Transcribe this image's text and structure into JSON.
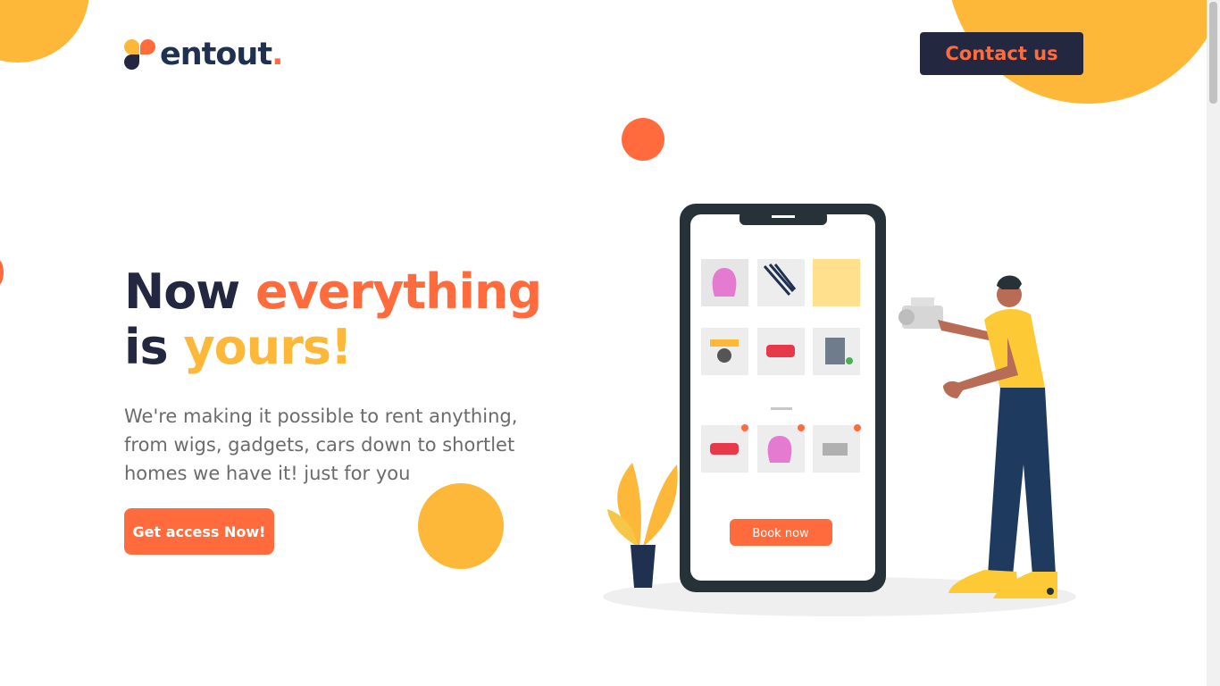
{
  "brand": {
    "name": "entout",
    "dot": "."
  },
  "header": {
    "contact_label": "Contact us"
  },
  "hero": {
    "title_part1": "Now ",
    "title_part2": "everything",
    "title_part3": "is ",
    "title_part4": "yours!",
    "description": "We're making it possible to rent anything, from wigs, gadgets, cars down to shortlet homes we have it! just for you",
    "cta_label": "Get access Now!"
  },
  "illustration": {
    "book_label": "Book now"
  },
  "colors": {
    "navy": "#232840",
    "orange": "#FF6B3D",
    "yellow": "#FDB739"
  }
}
